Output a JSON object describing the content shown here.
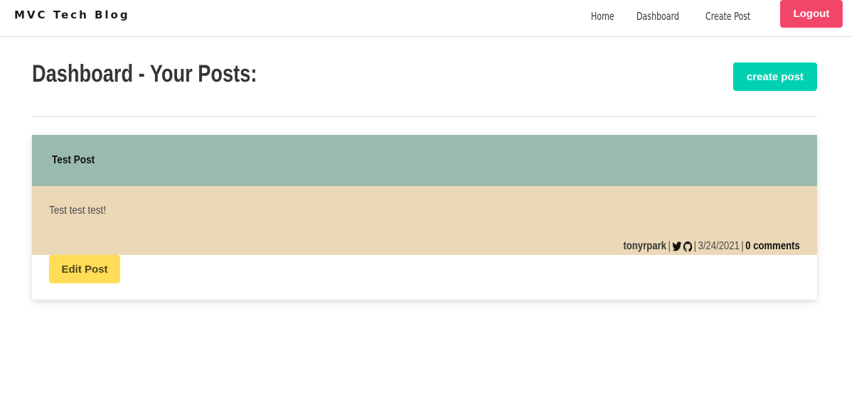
{
  "navbar": {
    "brand": "MVC Tech Blog",
    "links": [
      "Home",
      "Dashboard",
      "Create Post"
    ],
    "logout_label": "Logout"
  },
  "main": {
    "title": "Dashboard - Your Posts:",
    "create_post_label": "create post",
    "posts": [
      {
        "title": "Test Post",
        "content": "Test test test!",
        "author": "tonyrpark",
        "separator": "|",
        "date": "3/24/2021",
        "comments": "0 comments",
        "edit_label": "Edit Post"
      }
    ]
  },
  "colors": {
    "logout": "#f14668",
    "create_post": "#00d1b2",
    "post_header": "#99bbad",
    "post_body": "#ebd8b7",
    "edit_post": "#ffdd57"
  },
  "icons": [
    "twitter-icon",
    "github-icon"
  ]
}
